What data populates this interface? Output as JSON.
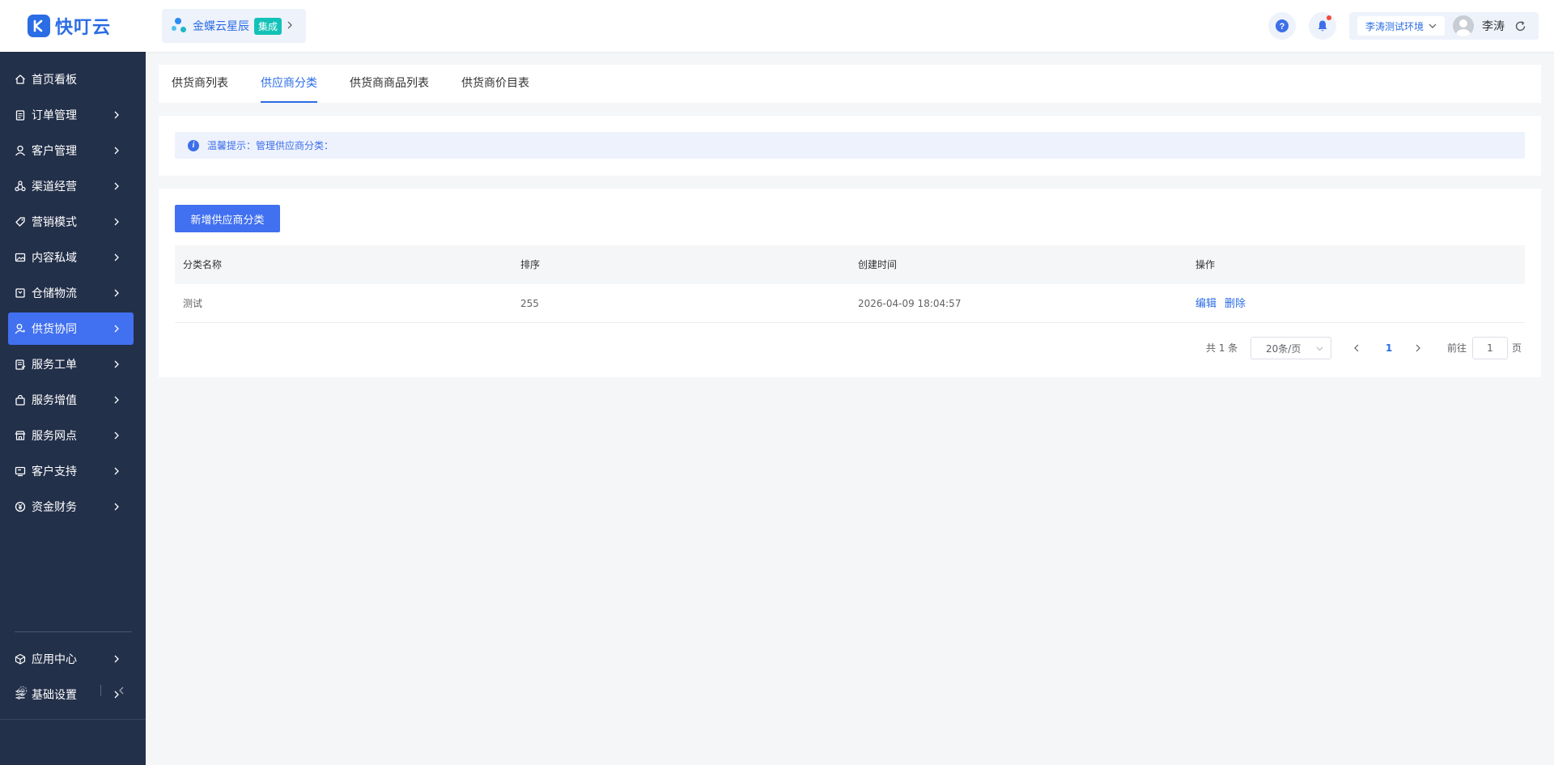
{
  "header": {
    "logo_text": "快叮云",
    "app_name": "金蝶云星辰",
    "app_tag": "集成",
    "env_label": "李涛测试环境",
    "username": "李涛"
  },
  "sidebar": {
    "items": [
      {
        "label": "首页看板",
        "icon": "home-icon",
        "has_arrow": false
      },
      {
        "label": "订单管理",
        "icon": "clipboard-icon",
        "has_arrow": true
      },
      {
        "label": "客户管理",
        "icon": "user-icon",
        "has_arrow": true
      },
      {
        "label": "渠道经营",
        "icon": "channel-icon",
        "has_arrow": true
      },
      {
        "label": "营销模式",
        "icon": "tag-icon",
        "has_arrow": true
      },
      {
        "label": "内容私域",
        "icon": "image-icon",
        "has_arrow": true
      },
      {
        "label": "仓储物流",
        "icon": "box-icon",
        "has_arrow": true
      },
      {
        "label": "供货协同",
        "icon": "supplier-icon",
        "has_arrow": true,
        "active": true
      },
      {
        "label": "服务工单",
        "icon": "ticket-icon",
        "has_arrow": true
      },
      {
        "label": "服务增值",
        "icon": "bag-icon",
        "has_arrow": true
      },
      {
        "label": "服务网点",
        "icon": "store-icon",
        "has_arrow": true
      },
      {
        "label": "客户支持",
        "icon": "support-icon",
        "has_arrow": true
      },
      {
        "label": "资金财务",
        "icon": "yuan-icon",
        "has_arrow": true
      }
    ],
    "bottom_items": [
      {
        "label": "应用中心",
        "icon": "cube-icon",
        "has_arrow": true
      },
      {
        "label": "基础设置",
        "icon": "settings-list-icon",
        "has_arrow": true
      }
    ]
  },
  "tabs": [
    {
      "label": "供货商列表",
      "active": false
    },
    {
      "label": "供应商分类",
      "active": true
    },
    {
      "label": "供货商商品列表",
      "active": false
    },
    {
      "label": "供货商价目表",
      "active": false
    }
  ],
  "tip": {
    "text": "温馨提示：管理供应商分类："
  },
  "toolbar": {
    "add_label": "新增供应商分类"
  },
  "table": {
    "headers": [
      "分类名称",
      "排序",
      "创建时间",
      "操作"
    ],
    "rows": [
      {
        "name": "测试",
        "sort": "255",
        "created": "2026-04-09 18:04:57",
        "actions": [
          "编辑",
          "删除"
        ]
      }
    ]
  },
  "pagination": {
    "total": "共 1 条",
    "page_size": "20条/页",
    "current_page": "1",
    "goto_label": "前往",
    "goto_value": "1",
    "page_suffix": "页"
  },
  "colors": {
    "accent": "#2b6de5",
    "sidebar_bg": "#23304a",
    "active_nav": "#4170f0",
    "tag": "#13c2b7",
    "notify": "#f5483b"
  }
}
